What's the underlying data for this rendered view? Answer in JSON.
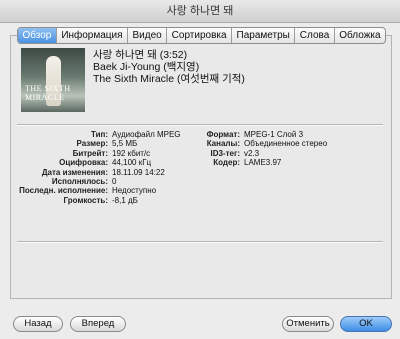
{
  "window": {
    "title": "사랑 하나면 돼"
  },
  "tabs": [
    "Обзор",
    "Информация",
    "Видео",
    "Сортировка",
    "Параметры",
    "Слова",
    "Обложка"
  ],
  "song": {
    "title_line": "사랑 하나면 돼 (3:52)",
    "artist": "Baek Ji-Young (백지영)",
    "album": "The Sixth Miracle (여섯번째 기적)",
    "artwork_text": "THE SIXTH MIRACLE"
  },
  "details_left": [
    {
      "label": "Тип:",
      "value": "Аудиофайл MPEG"
    },
    {
      "label": "Размер:",
      "value": "5,5 МБ"
    },
    {
      "label": "Битрейт:",
      "value": "192 кбит/с"
    },
    {
      "label": "Оцифровка:",
      "value": "44,100 кГц"
    },
    {
      "label": "Дата изменения:",
      "value": "18.11.09 14:22"
    },
    {
      "label": "Исполнялось:",
      "value": "0"
    },
    {
      "label": "Последн. исполнение:",
      "value": "Недоступно"
    },
    {
      "label": "Громкость:",
      "value": "-8,1 дБ"
    }
  ],
  "details_right": [
    {
      "label": "Формат:",
      "value": "MPEG-1 Слой 3"
    },
    {
      "label": "Каналы:",
      "value": "Объединенное стерео"
    },
    {
      "label": "ID3-тег:",
      "value": "v2.3"
    },
    {
      "label": "Кодер:",
      "value": "LAME3.97"
    }
  ],
  "buttons": {
    "back": "Назад",
    "next": "Вперед",
    "cancel": "Отменить",
    "ok": "OK"
  }
}
